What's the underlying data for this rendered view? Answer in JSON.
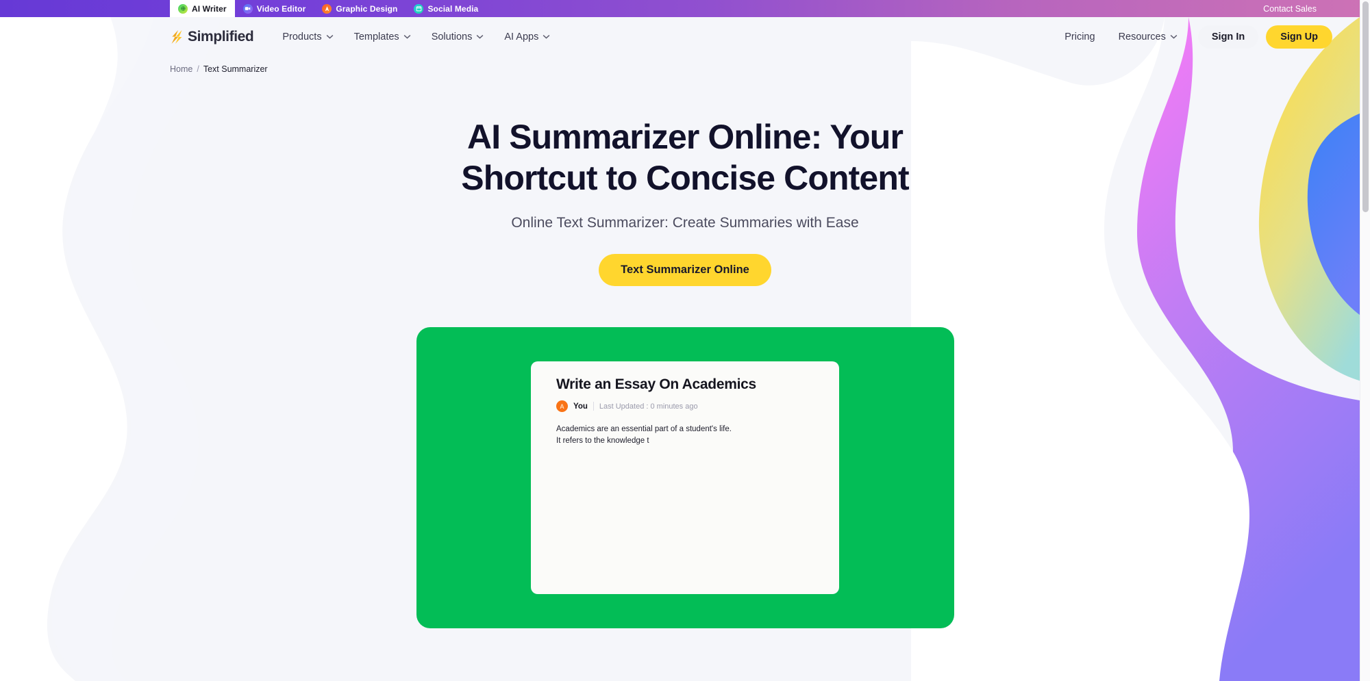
{
  "topbar": {
    "apps": [
      {
        "label": "AI Writer",
        "icon": "ai-writer-icon",
        "active": true
      },
      {
        "label": "Video Editor",
        "icon": "video-editor-icon",
        "active": false
      },
      {
        "label": "Graphic Design",
        "icon": "graphic-design-icon",
        "active": false
      },
      {
        "label": "Social Media",
        "icon": "social-media-icon",
        "active": false
      }
    ],
    "contact_sales": "Contact Sales",
    "gradient_from": "#6639d6",
    "gradient_to": "#cd72b5"
  },
  "nav": {
    "logo_text": "Simplified",
    "logo_icon": "simplified-bolt-logo",
    "links": [
      {
        "label": "Products",
        "has_dropdown": true
      },
      {
        "label": "Templates",
        "has_dropdown": true
      },
      {
        "label": "Solutions",
        "has_dropdown": true
      },
      {
        "label": "AI Apps",
        "has_dropdown": true
      }
    ],
    "right_links": [
      {
        "label": "Pricing",
        "has_dropdown": false
      },
      {
        "label": "Resources",
        "has_dropdown": true
      }
    ],
    "sign_in": "Sign In",
    "sign_up": "Sign Up",
    "signup_color": "#ffd62e"
  },
  "breadcrumb": {
    "home": "Home",
    "separator": "/",
    "current": "Text Summarizer"
  },
  "hero": {
    "title": "AI Summarizer Online: Your Shortcut to Concise Content",
    "subtitle": "Online Text Summarizer: Create Summaries with Ease",
    "cta_label": "Text Summarizer Online",
    "cta_color": "#ffd62e"
  },
  "showcase": {
    "background_color": "#03bd56",
    "document": {
      "title": "Write an Essay On Academics",
      "avatar_initial": "A",
      "author": "You",
      "updated": "Last Updated : 0 minutes ago",
      "body_lines": [
        "Academics are an essential part of a student's life.",
        "It refers to the knowledge t"
      ]
    }
  },
  "scrollbar": {
    "name": "page-scrollbar"
  }
}
